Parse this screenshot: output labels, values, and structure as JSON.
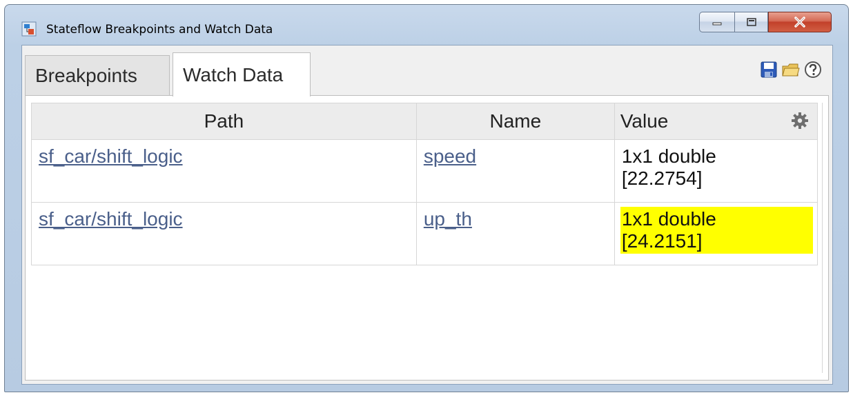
{
  "window": {
    "title": "Stateflow Breakpoints and Watch Data",
    "app_icon": "stateflow-app-icon",
    "controls": [
      "minimize-icon",
      "maximize-icon",
      "close-icon"
    ]
  },
  "tabs": [
    {
      "label": "Breakpoints",
      "active": false
    },
    {
      "label": "Watch Data",
      "active": true
    }
  ],
  "toolbar": {
    "icons": [
      "save-icon",
      "open-folder-icon",
      "help-icon"
    ]
  },
  "table": {
    "columns": {
      "path": "Path",
      "name": "Name",
      "value": "Value"
    },
    "settings_icon": "gear-icon",
    "rows": [
      {
        "path": "sf_car/shift_logic",
        "name": "speed",
        "value_line1": "1x1 double",
        "value_line2": "[22.2754]",
        "highlighted": false
      },
      {
        "path": "sf_car/shift_logic",
        "name": "up_th",
        "value_line1": "1x1 double",
        "value_line2": "[24.2151]",
        "highlighted": true
      }
    ]
  },
  "colors": {
    "highlight": "#ffff00",
    "link": "#4a5f8a",
    "header_bg": "#ececec"
  }
}
